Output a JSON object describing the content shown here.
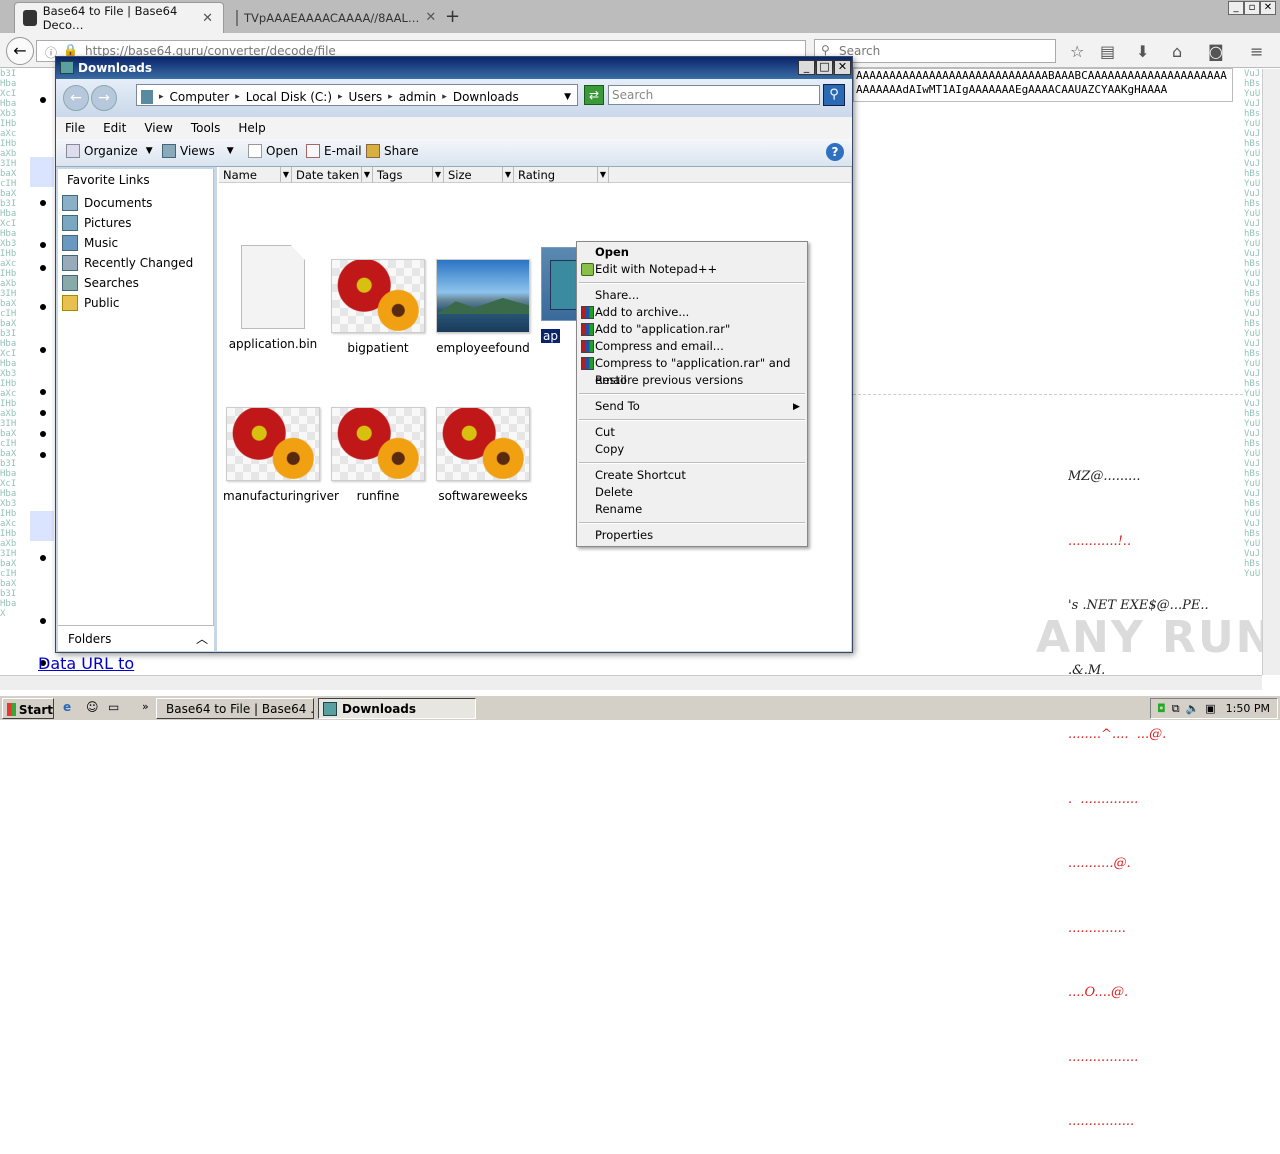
{
  "browser": {
    "tabs": [
      {
        "label": "Base64 to File | Base64 Deco…",
        "active": true
      },
      {
        "label": "TVpAAAEAAAACAAAA//8AAL…",
        "active": false
      }
    ],
    "url": "https://base64.guru/converter/decode/file",
    "search_placeholder": "Search"
  },
  "page": {
    "hex_line1": "AAAAAAAAAAAAAAAAAAAAAAAAAAAAABAAABCAAAAAAAAAAAAAAAAAAAAA",
    "hex_line2": "AAAAAAAdAIwMT1AIgAAAAAAAEgAAAACAAUAZCYAAKgHAAAA",
    "link_text": "Data URL to",
    "watermark": "ANY RUN",
    "ascii_lines": [
      "MZ@.........",
      "............!..",
      "'s .NET EXE$@...PE..",
      ".&.M.",
      "........^....  ...@.",
      ".  ..............",
      "...........@.",
      "..............",
      "....O....@.",
      ".................",
      "................"
    ]
  },
  "explorer": {
    "title": "Downloads",
    "breadcrumb": [
      "Computer",
      "Local Disk (C:)",
      "Users",
      "admin",
      "Downloads"
    ],
    "search_placeholder": "Search",
    "menu": [
      "File",
      "Edit",
      "View",
      "Tools",
      "Help"
    ],
    "toolbar": {
      "organize": "Organize",
      "views": "Views",
      "open": "Open",
      "email": "E-mail",
      "share": "Share"
    },
    "nav": {
      "title": "Favorite Links",
      "items": [
        "Documents",
        "Pictures",
        "Music",
        "Recently Changed",
        "Searches",
        "Public"
      ],
      "folders_label": "Folders"
    },
    "columns": [
      "Name",
      "Date taken",
      "Tags",
      "Size",
      "Rating"
    ],
    "files": [
      {
        "name": "application.bin",
        "kind": "doc"
      },
      {
        "name": "bigpatient",
        "kind": "flower"
      },
      {
        "name": "employeefound",
        "kind": "landscape"
      },
      {
        "name": "ap",
        "kind": "selected"
      },
      {
        "name": "",
        "kind": "landscape"
      },
      {
        "name": "manufacturingriver",
        "kind": "flower"
      },
      {
        "name": "runfine",
        "kind": "flower"
      },
      {
        "name": "softwareweeks",
        "kind": "flower"
      }
    ]
  },
  "context_menu": {
    "items": [
      "Open",
      "Edit with Notepad++",
      "Share...",
      "Add to archive...",
      "Add to \"application.rar\"",
      "Compress and email...",
      "Compress to \"application.rar\" and email",
      "Restore previous versions",
      "Send To",
      "Cut",
      "Copy",
      "Create Shortcut",
      "Delete",
      "Rename",
      "Properties"
    ]
  },
  "taskbar": {
    "start": "Start",
    "tasks": [
      "Base64 to File | Base64 ...",
      "Downloads"
    ],
    "time": "1:50 PM"
  }
}
